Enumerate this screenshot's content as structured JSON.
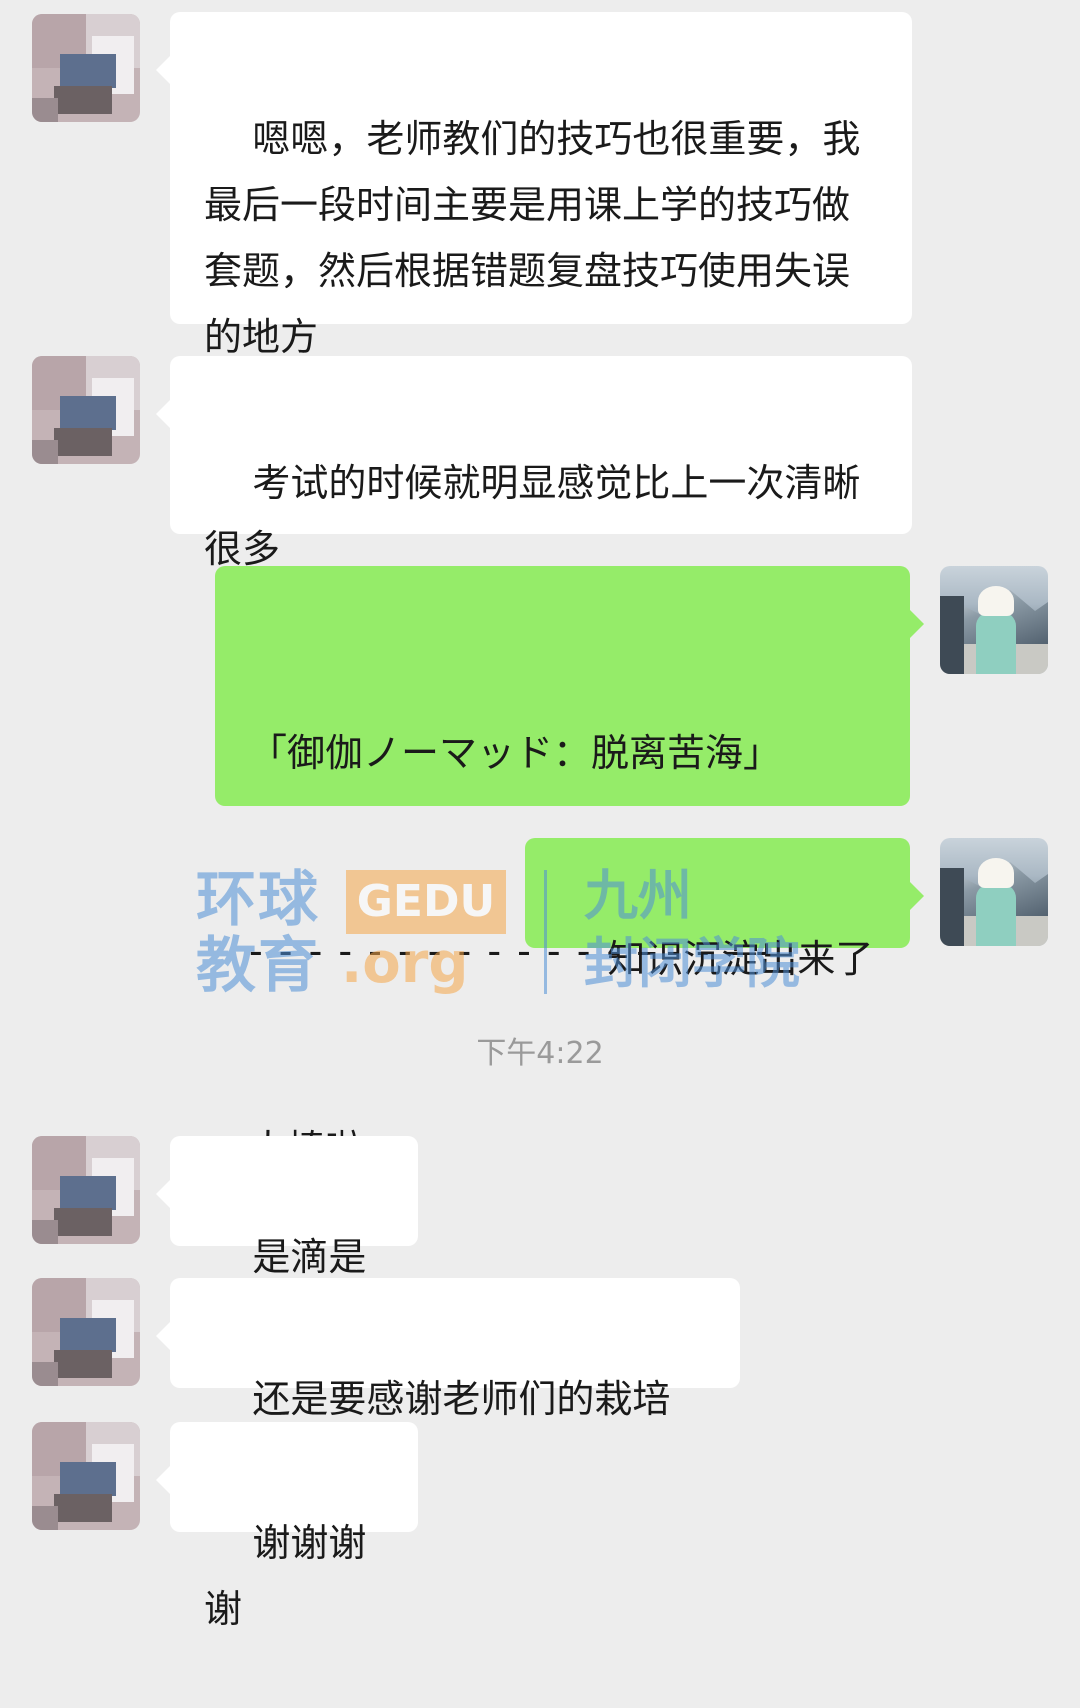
{
  "messages": [
    {
      "side": "left",
      "text": "嗯嗯，老师教们的技巧也很重要，我最后一段时间主要是用课上学的技巧做套题，然后根据错题复盘技巧使用失误的地方"
    },
    {
      "side": "left",
      "text": "考试的时候就明显感觉比上一次清晰很多"
    },
    {
      "side": "right",
      "quote": "「御伽ノーマッド：脱离苦海」",
      "divider": "- - - - - - - - - - - - - - - - - -",
      "text": "太棒啦"
    },
    {
      "side": "right",
      "text": "知识沉淀出来了"
    },
    {
      "side": "left",
      "text": "是滴是滴"
    },
    {
      "side": "left",
      "text": "还是要感谢老师们的栽培"
    },
    {
      "side": "left",
      "text": "谢谢谢谢"
    }
  ],
  "timestamp": "下午4:22",
  "watermark": {
    "brand_cn_line1": "环球",
    "brand_cn_line2": "教育",
    "brand_en": "GEDU",
    "brand_org": ".org",
    "school_line1": "九州",
    "school_line2": "封闭学院"
  },
  "colors": {
    "background": "#ededed",
    "bubble_left": "#ffffff",
    "bubble_right": "#95ec69",
    "timestamp": "#9a9a9a"
  }
}
